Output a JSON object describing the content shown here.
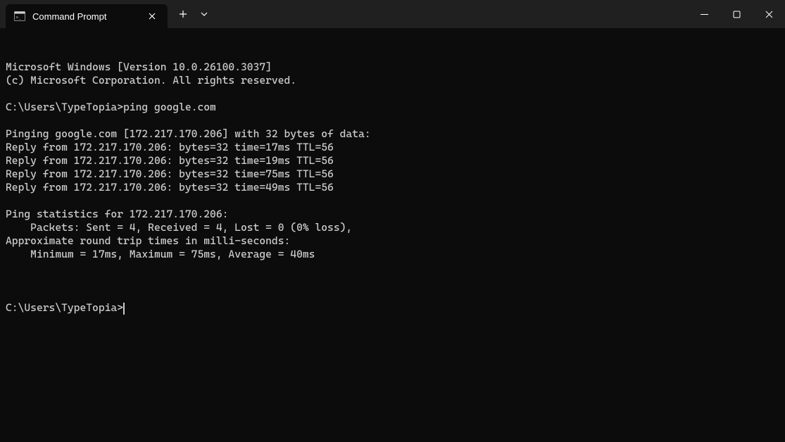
{
  "titlebar": {
    "tab_title": "Command Prompt"
  },
  "terminal": {
    "lines": [
      "Microsoft Windows [Version 10.0.26100.3037]",
      "(c) Microsoft Corporation. All rights reserved.",
      "",
      "C:\\Users\\TypeTopia>ping google.com",
      "",
      "Pinging google.com [172.217.170.206] with 32 bytes of data:",
      "Reply from 172.217.170.206: bytes=32 time=17ms TTL=56",
      "Reply from 172.217.170.206: bytes=32 time=19ms TTL=56",
      "Reply from 172.217.170.206: bytes=32 time=75ms TTL=56",
      "Reply from 172.217.170.206: bytes=32 time=49ms TTL=56",
      "",
      "Ping statistics for 172.217.170.206:",
      "    Packets: Sent = 4, Received = 4, Lost = 0 (0% loss),",
      "Approximate round trip times in milli-seconds:",
      "    Minimum = 17ms, Maximum = 75ms, Average = 40ms",
      ""
    ],
    "prompt": "C:\\Users\\TypeTopia>"
  }
}
